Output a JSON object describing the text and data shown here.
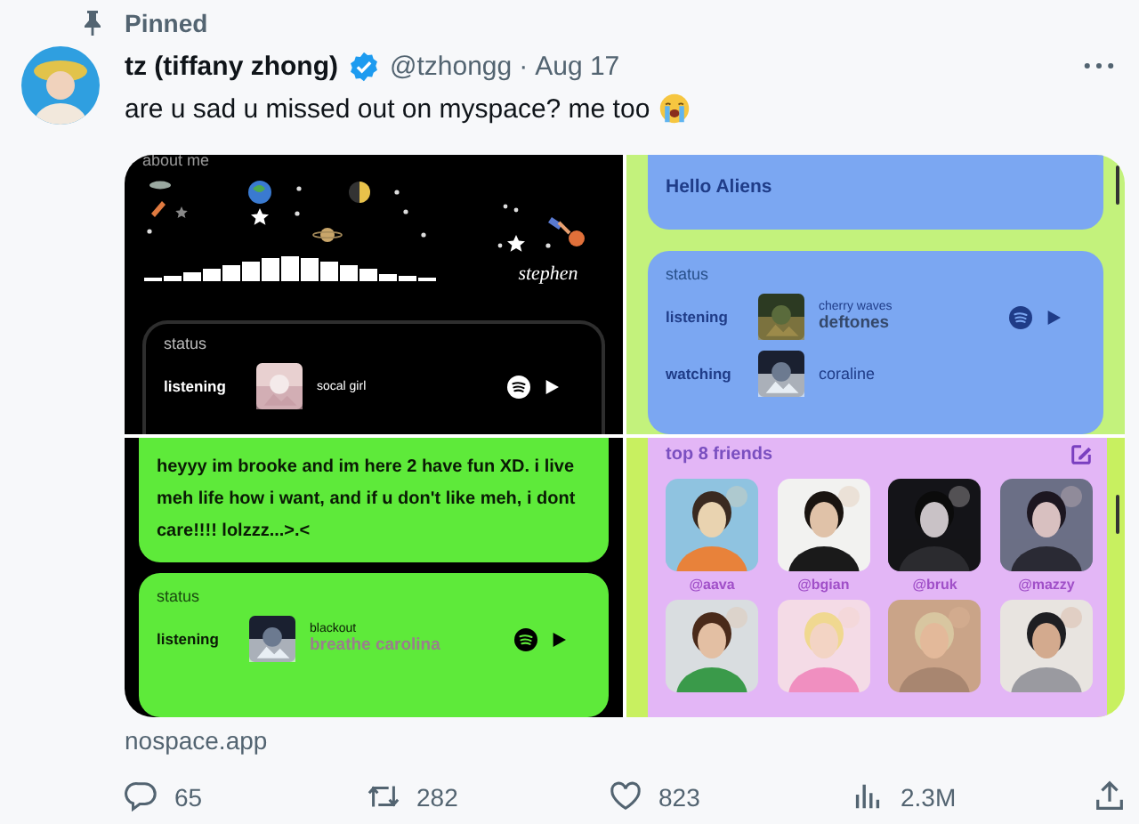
{
  "pinned_label": "Pinned",
  "tweet": {
    "author_name": "tz (tiffany zhong)",
    "verified": true,
    "handle": "@tzhongg",
    "separator": "·",
    "date": "Aug 17",
    "text": "are u sad u missed out on myspace? me too"
  },
  "media": {
    "panels": [
      {
        "kind": "space_profile",
        "heading": "about me",
        "signature": "stephen",
        "status": {
          "heading": "status",
          "rows": [
            {
              "label": "listening",
              "title": "socal girl",
              "player": true
            }
          ]
        }
      },
      {
        "kind": "blue_profile",
        "bio": "Hello Aliens",
        "status": {
          "heading": "status",
          "rows": [
            {
              "label": "listening",
              "title": "cherry waves",
              "artist": "deftones",
              "player": true
            },
            {
              "label": "watching",
              "title": "coraline",
              "player": false
            }
          ]
        }
      },
      {
        "kind": "green_profile",
        "bio": "heyyy im brooke and im here 2 have fun XD. i live meh life how i want, and if u don't like meh, i dont care!!!! lolzzz...>.<",
        "status": {
          "heading": "status",
          "rows": [
            {
              "label": "listening",
              "title": "blackout",
              "artist": "breathe carolina",
              "player": true
            }
          ]
        }
      },
      {
        "kind": "friends",
        "heading": "top 8 friends",
        "friends": [
          {
            "kind": "picture",
            "handle": "@aava"
          },
          {
            "kind": "picture",
            "handle": "@bgian"
          },
          {
            "kind": "picture",
            "handle": "@bruk"
          },
          {
            "kind": "picture",
            "handle": "@mazzy"
          },
          {
            "kind": "picture"
          },
          {
            "kind": "picture"
          },
          {
            "kind": "picture"
          },
          {
            "kind": "picture"
          }
        ]
      }
    ]
  },
  "link": "nospace.app",
  "actions": [
    {
      "kind": "reply",
      "count": "65"
    },
    {
      "kind": "retweet",
      "count": "282"
    },
    {
      "kind": "like",
      "count": "823"
    },
    {
      "kind": "views",
      "count": "2.3M"
    },
    {
      "kind": "share"
    }
  ]
}
